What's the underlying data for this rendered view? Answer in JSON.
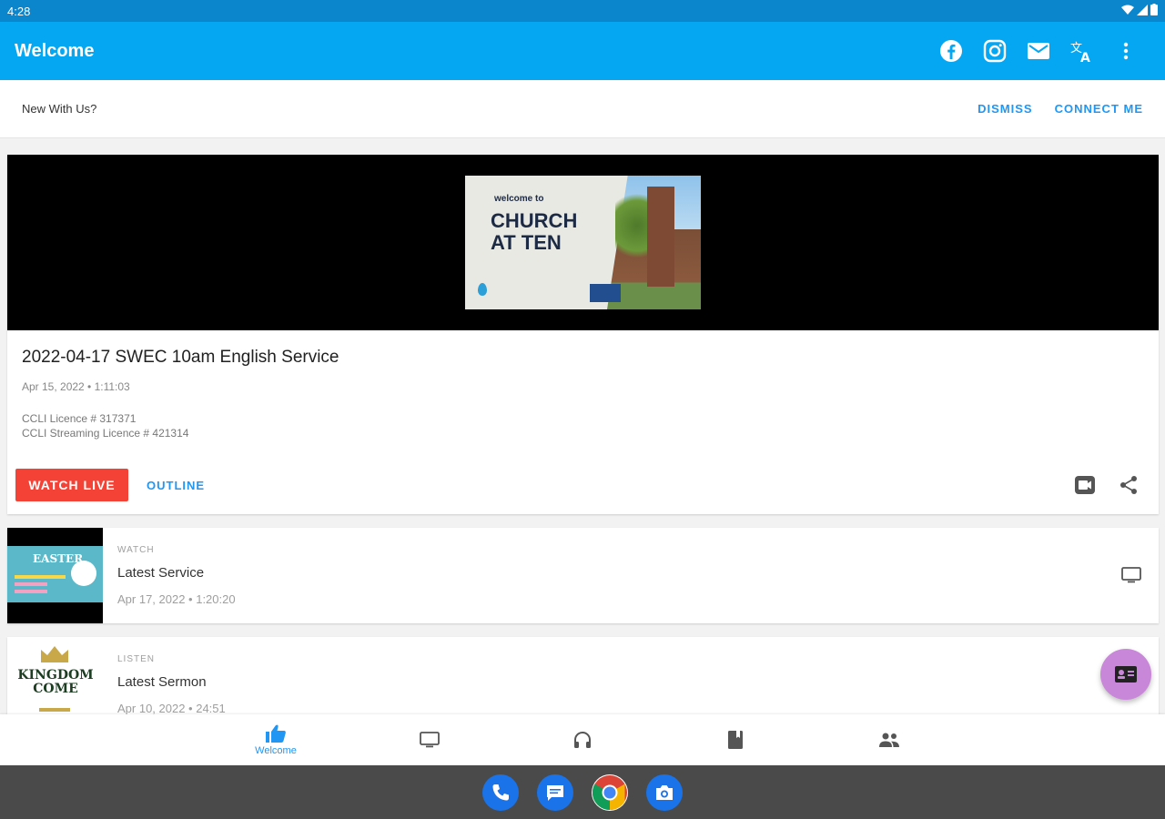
{
  "status_bar": {
    "time": "4:28"
  },
  "app_bar": {
    "title": "Welcome",
    "actions": [
      "facebook-icon",
      "instagram-icon",
      "mail-icon",
      "translate-icon",
      "more-vert-icon"
    ]
  },
  "banner": {
    "prompt": "New With Us?",
    "dismiss_label": "DISMISS",
    "connect_label": "CONNECT ME"
  },
  "feature": {
    "poster": {
      "welcome_to": "welcome to",
      "title_line1": "CHURCH",
      "title_line2": "AT TEN"
    },
    "title": "2022-04-17 SWEC 10am English Service",
    "meta": "Apr 15, 2022 • 1:11:03",
    "desc_line1": "CCLI Licence # 317371",
    "desc_line2": "CCLI Streaming Licence # 421314",
    "watch_label": "WATCH LIVE",
    "outline_label": "OUTLINE",
    "accent": "#f44336"
  },
  "list": [
    {
      "kicker": "WATCH",
      "title": "Latest Service",
      "meta": "Apr 17, 2022 • 1:20:20",
      "thumb_text": "EASTER",
      "end_icon": "tv-icon"
    },
    {
      "kicker": "LISTEN",
      "title": "Latest Sermon",
      "meta": "Apr 10, 2022 • 24:51",
      "thumb_line1": "KINGDOM",
      "thumb_line2": "COME"
    }
  ],
  "bottom_nav": {
    "active_label": "Welcome",
    "items": [
      "thumb-up-icon",
      "tv-icon",
      "headphones-icon",
      "book-icon",
      "people-icon"
    ]
  },
  "colors": {
    "app_bar": "#05a7f2",
    "status_bar": "#0b86cc",
    "link": "#2196f3",
    "fab": "#c987d9"
  }
}
